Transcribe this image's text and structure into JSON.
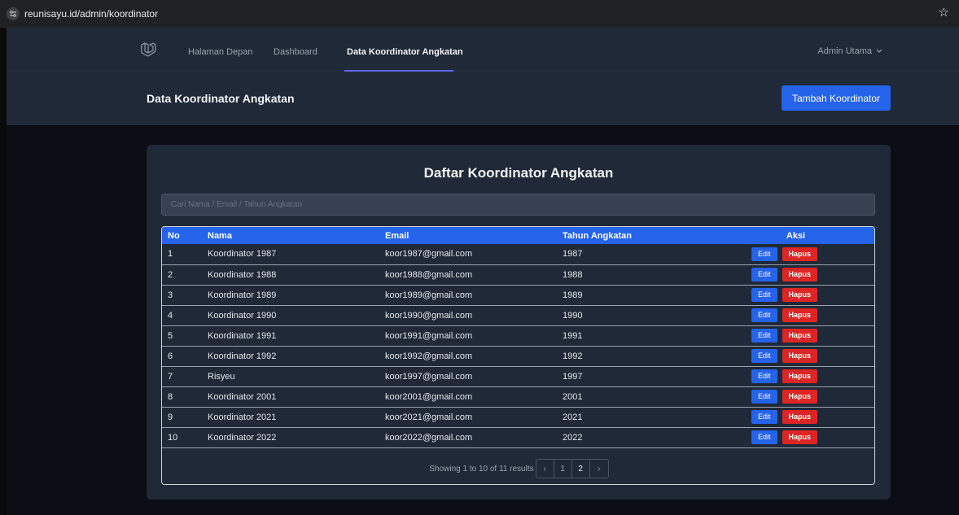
{
  "browser": {
    "url": "reunisayu.id/admin/koordinator",
    "site_icon": "tune-icon",
    "star_icon": "☆"
  },
  "navbar": {
    "links": [
      {
        "label": "Halaman Depan"
      },
      {
        "label": "Dashboard"
      },
      {
        "label": "Data Koordinator Angkatan"
      }
    ],
    "user": "Admin Utama"
  },
  "header": {
    "title": "Data Koordinator Angkatan",
    "add_button": "Tambah Koordinator"
  },
  "card": {
    "title": "Daftar Koordinator Angkatan",
    "search_placeholder": "Cari Nama / Email / Tahun Angkatan"
  },
  "table": {
    "columns": [
      "No",
      "Nama",
      "Email",
      "Tahun Angkatan",
      "Aksi"
    ],
    "edit_label": "Edit",
    "delete_label": "Hapus",
    "rows": [
      {
        "no": "1",
        "nama": "Koordinator 1987",
        "email": "koor1987@gmail.com",
        "tahun": "1987"
      },
      {
        "no": "2",
        "nama": "Koordinator 1988",
        "email": "koor1988@gmail.com",
        "tahun": "1988"
      },
      {
        "no": "3",
        "nama": "Koordinator 1989",
        "email": "koor1989@gmail.com",
        "tahun": "1989"
      },
      {
        "no": "4",
        "nama": "Koordinator 1990",
        "email": "koor1990@gmail.com",
        "tahun": "1990"
      },
      {
        "no": "5",
        "nama": "Koordinator 1991",
        "email": "koor1991@gmail.com",
        "tahun": "1991"
      },
      {
        "no": "6",
        "nama": "Koordinator 1992",
        "email": "koor1992@gmail.com",
        "tahun": "1992"
      },
      {
        "no": "7",
        "nama": "Risyeu",
        "email": "koor1997@gmail.com",
        "tahun": "1997"
      },
      {
        "no": "8",
        "nama": "Koordinator 2001",
        "email": "koor2001@gmail.com",
        "tahun": "2001"
      },
      {
        "no": "9",
        "nama": "Koordinator 2021",
        "email": "koor2021@gmail.com",
        "tahun": "2021"
      },
      {
        "no": "10",
        "nama": "Koordinator 2022",
        "email": "koor2022@gmail.com",
        "tahun": "2022"
      }
    ]
  },
  "pagination": {
    "results_text": "Showing 1 to 10 of 11 results",
    "prev": "‹",
    "pages": [
      "1",
      "2"
    ],
    "next": "›"
  }
}
